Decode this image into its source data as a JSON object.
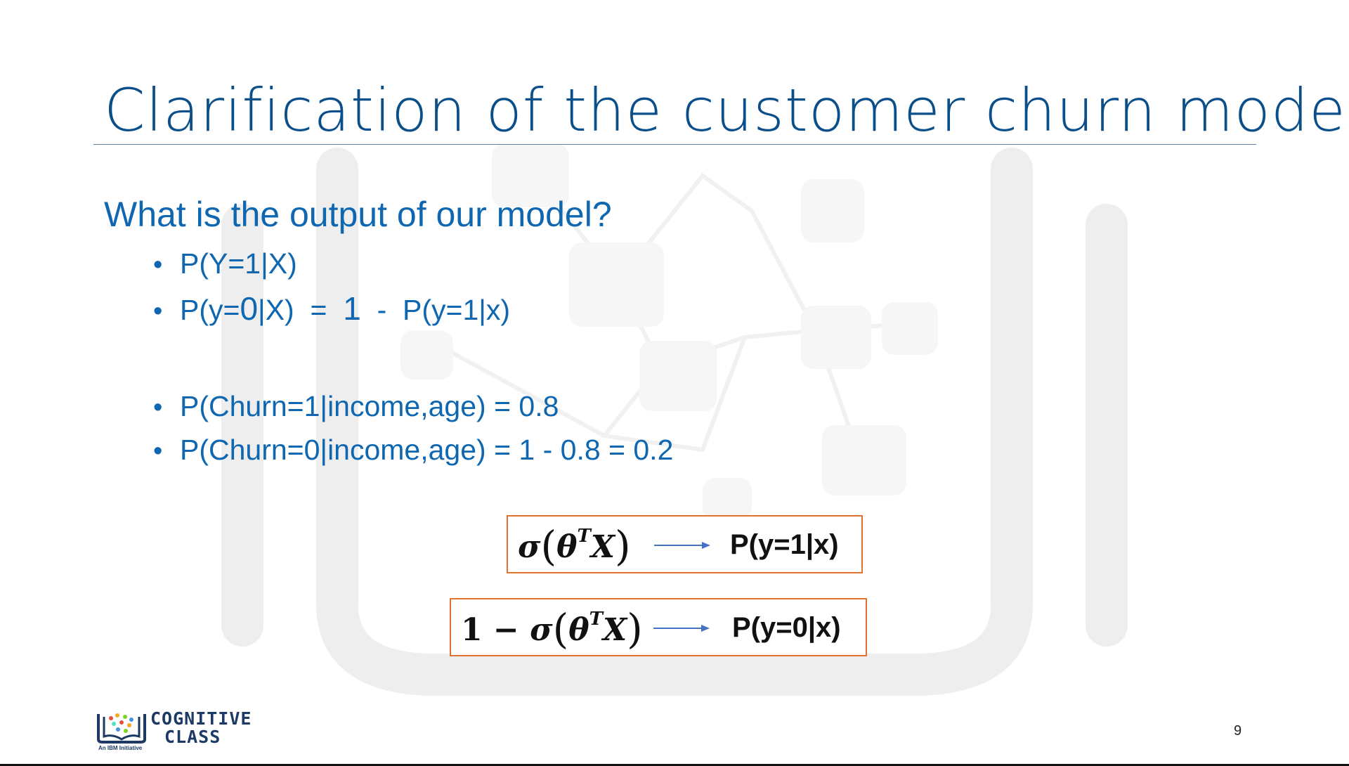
{
  "slide": {
    "title": "Clarification of the customer churn model",
    "question": "What is the output of our model?",
    "bullets": [
      "P(Y=1|X)",
      {
        "a": "P(y=",
        "b": "0",
        "c": "|X)  =  ",
        "d": "1",
        "e": "  -  P(y=1|x)"
      },
      "P(Churn=1|income,age) = 0.8",
      "P(Churn=0|income,age) = 1 - 0.8 = 0.2"
    ],
    "bullet_symbol": "•",
    "formulas": [
      {
        "prefix": "",
        "sigma": "σ",
        "theta": "θ",
        "superscript": "T",
        "var": "X",
        "result": "P(y=1|x)"
      },
      {
        "prefix": "1 − ",
        "sigma": "σ",
        "theta": "θ",
        "superscript": "T",
        "var": "X",
        "result": "P(y=0|x)"
      }
    ],
    "paren_open": "(",
    "paren_close": ")",
    "page_number": "9"
  },
  "logo": {
    "line1": "COGNITIVE",
    "line2": "CLASS",
    "tagline": "An IBM Initiative",
    "icon": "book-icon"
  },
  "colors": {
    "title": "#0b4f8a",
    "text": "#0e67b0",
    "box_border": "#e0742e",
    "arrow": "#4472c4"
  }
}
